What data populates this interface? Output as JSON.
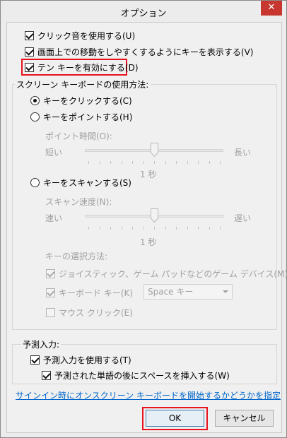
{
  "window": {
    "title": "オプション",
    "close_glyph": "✕"
  },
  "options": {
    "click_sound": {
      "label": "クリック音を使用する(U)",
      "checked": true
    },
    "show_moving_keys": {
      "label": "画面上での移動をしやすくするようにキーを表示する(V)",
      "checked": true
    },
    "numeric_keypad": {
      "label": "テン キーを有効にする(D)",
      "checked": true
    }
  },
  "usage": {
    "label": "スクリーン キーボードの使用方法:",
    "click_keys": {
      "label": "キーをクリックする(C)",
      "selected": true
    },
    "hover_keys": {
      "label": "キーをポイントする(H)",
      "selected": false,
      "duration_label": "ポイント時間(O):",
      "min_label": "短い",
      "max_label": "長い",
      "value_text": "1 秒",
      "level": 0.5
    },
    "scan_keys": {
      "label": "キーをスキャンする(S)",
      "selected": false,
      "speed_label": "スキャン速度(N):",
      "min_label": "速い",
      "max_label": "遅い",
      "value_text": "1 秒",
      "level": 0.5,
      "key_selection_label": "キーの選択方法:",
      "joystick": {
        "label": "ジョイスティック、ゲーム パッドなどのゲーム デバイス(M)",
        "checked": true
      },
      "keyboard_key": {
        "label": "キーボード キー(K)",
        "checked": true,
        "select_value": "Space キー"
      },
      "mouse_click": {
        "label": "マウス クリック(E)",
        "checked": false
      }
    }
  },
  "prediction": {
    "label": "予測入力:",
    "use_prediction": {
      "label": "予測入力を使用する(T)",
      "checked": true
    },
    "insert_space": {
      "label": "予測された単語の後にスペースを挿入する(W)",
      "checked": true
    }
  },
  "signin_link": "サインイン時にオンスクリーン キーボードを開始するかどうかを指定",
  "buttons": {
    "ok": "OK",
    "cancel": "キャンセル"
  },
  "colors": {
    "highlight": "#e8131d",
    "link": "#0066cc",
    "close": "#c7372f"
  }
}
